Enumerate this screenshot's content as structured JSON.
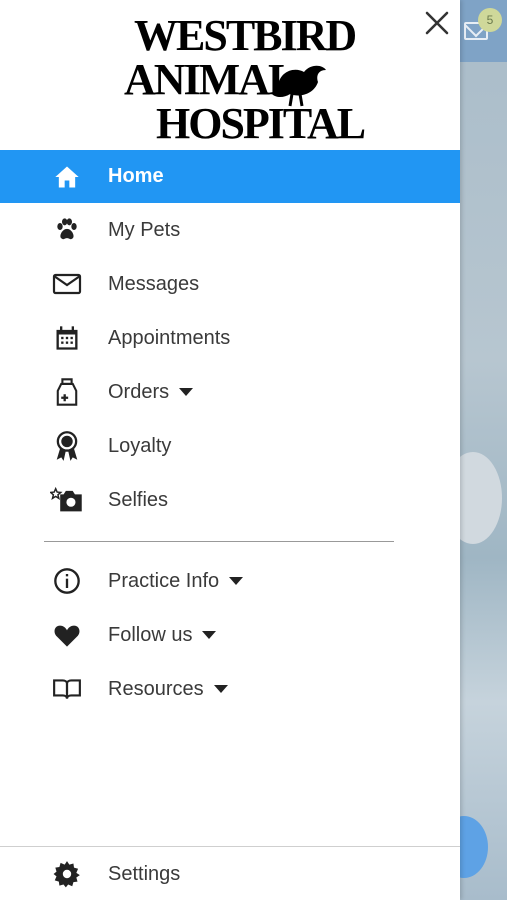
{
  "background": {
    "unread_count": "5"
  },
  "drawer": {
    "logo": {
      "line1": "WESTBIRD",
      "line2": "ANIMAL",
      "line3": "HOSPITAL"
    },
    "accent_color": "#2196f3",
    "primary_items": [
      {
        "label": "Home",
        "icon": "home-icon",
        "active": true
      },
      {
        "label": "My Pets",
        "icon": "paw-icon"
      },
      {
        "label": "Messages",
        "icon": "mail-icon"
      },
      {
        "label": "Appointments",
        "icon": "calendar-icon"
      },
      {
        "label": "Orders",
        "icon": "medicine-bag-icon",
        "expandable": true
      },
      {
        "label": "Loyalty",
        "icon": "award-ribbon-icon"
      },
      {
        "label": "Selfies",
        "icon": "camera-star-icon"
      }
    ],
    "secondary_items": [
      {
        "label": "Practice Info",
        "icon": "info-icon",
        "expandable": true
      },
      {
        "label": "Follow us",
        "icon": "heart-icon",
        "expandable": true
      },
      {
        "label": "Resources",
        "icon": "book-icon",
        "expandable": true
      }
    ],
    "settings": {
      "label": "Settings",
      "icon": "gear-icon"
    }
  }
}
